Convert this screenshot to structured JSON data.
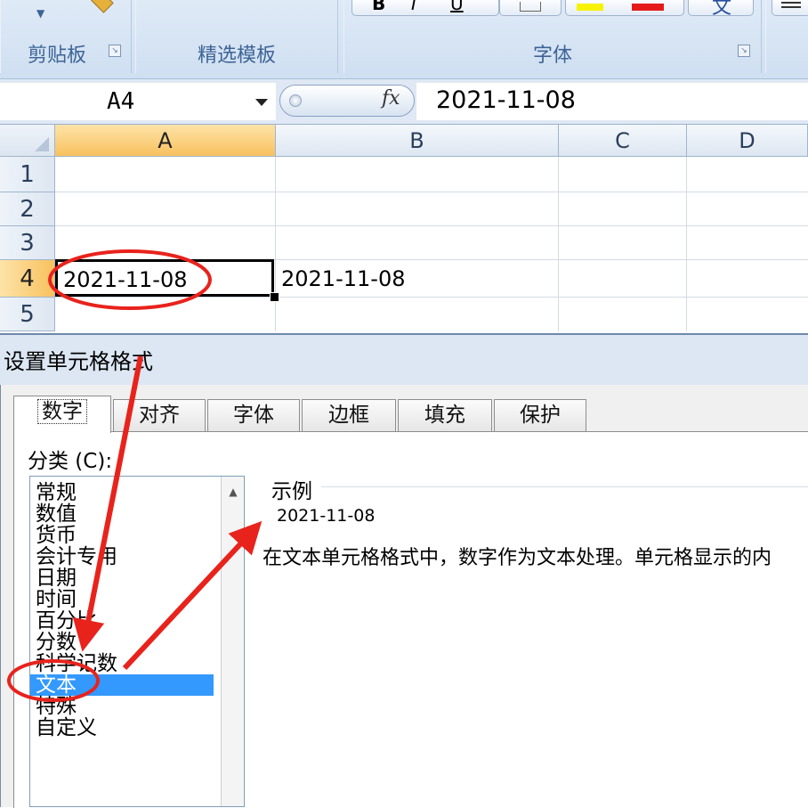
{
  "ribbon": {
    "groups": [
      {
        "label": "剪贴板"
      },
      {
        "label": "精选模板"
      },
      {
        "label": "字体"
      }
    ]
  },
  "formula_bar": {
    "name_box": "A4",
    "fx_label": "fx",
    "formula_value": "2021-11-08"
  },
  "sheet": {
    "columns": [
      "A",
      "B",
      "C",
      "D"
    ],
    "selected_column": "A",
    "rows": [
      "1",
      "2",
      "3",
      "4",
      "5"
    ],
    "selected_row": "4",
    "cells": {
      "A4": "2021-11-08",
      "B4": "2021-11-08"
    }
  },
  "dialog": {
    "title": "设置单元格格式",
    "tabs": [
      "数字",
      "对齐",
      "字体",
      "边框",
      "填充",
      "保护"
    ],
    "active_tab": "数字",
    "category_label": "分类 (C):",
    "categories": [
      "常规",
      "数值",
      "货币",
      "会计专用",
      "日期",
      "时间",
      "百分比",
      "分数",
      "科学记数",
      "文本",
      "特殊",
      "自定义"
    ],
    "selected_category": "文本",
    "sample_label": "示例",
    "sample_value": "2021-11-08",
    "description": "在文本单元格格式中，数字作为文本处理。单元格显示的内"
  },
  "colors": {
    "annotation_red": "#e8231c",
    "selection_blue": "#3399ff",
    "header_highlight": "#f8c15f"
  }
}
